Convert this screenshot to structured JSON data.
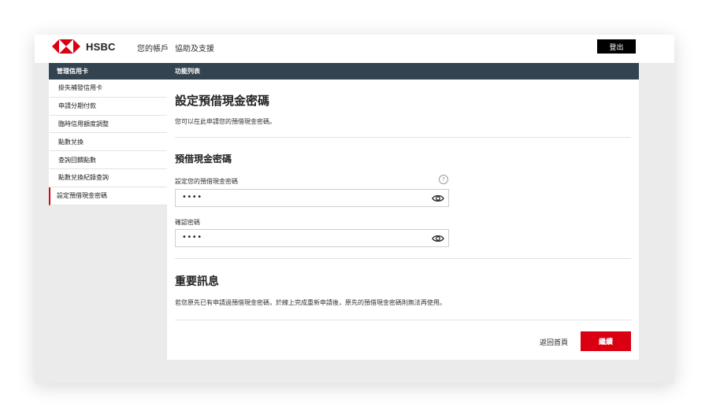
{
  "app": {
    "brand": "HSBC",
    "brand_color": "#db0011"
  },
  "topnav": {
    "accounts": "您的帳戶",
    "help": "協助及支援",
    "logout": "登出"
  },
  "header_bar": {
    "left": "管理信用卡",
    "right": "功能列表"
  },
  "sidebar": {
    "items": [
      {
        "label": "掛失補發信用卡",
        "active": false
      },
      {
        "label": "申請分期付款",
        "active": false
      },
      {
        "label": "臨時信用額度調整",
        "active": false
      },
      {
        "label": "點數兌換",
        "active": false
      },
      {
        "label": "查詢回饋點數",
        "active": false
      },
      {
        "label": "點數兌換紀錄查詢",
        "active": false
      },
      {
        "label": "設定預借現金密碼",
        "active": true
      }
    ]
  },
  "main": {
    "title": "設定預借現金密碼",
    "description": "您可以在此申請您的預借現金密碼。",
    "section_title": "預借現金密碼",
    "help_glyph": "?",
    "fields": [
      {
        "label": "設定您的預借現金密碼",
        "value": "••••",
        "icon": "eye-icon"
      },
      {
        "label": "確認密碼",
        "value": "••••",
        "icon": "eye-icon"
      }
    ],
    "important_title": "重要訊息",
    "important_text": "若您原先已有申請過預借現金密碼，於線上完成重新申請後，原先的預借現金密碼則無法再使用。",
    "back_link": "返回首頁",
    "continue_button": "繼續"
  }
}
